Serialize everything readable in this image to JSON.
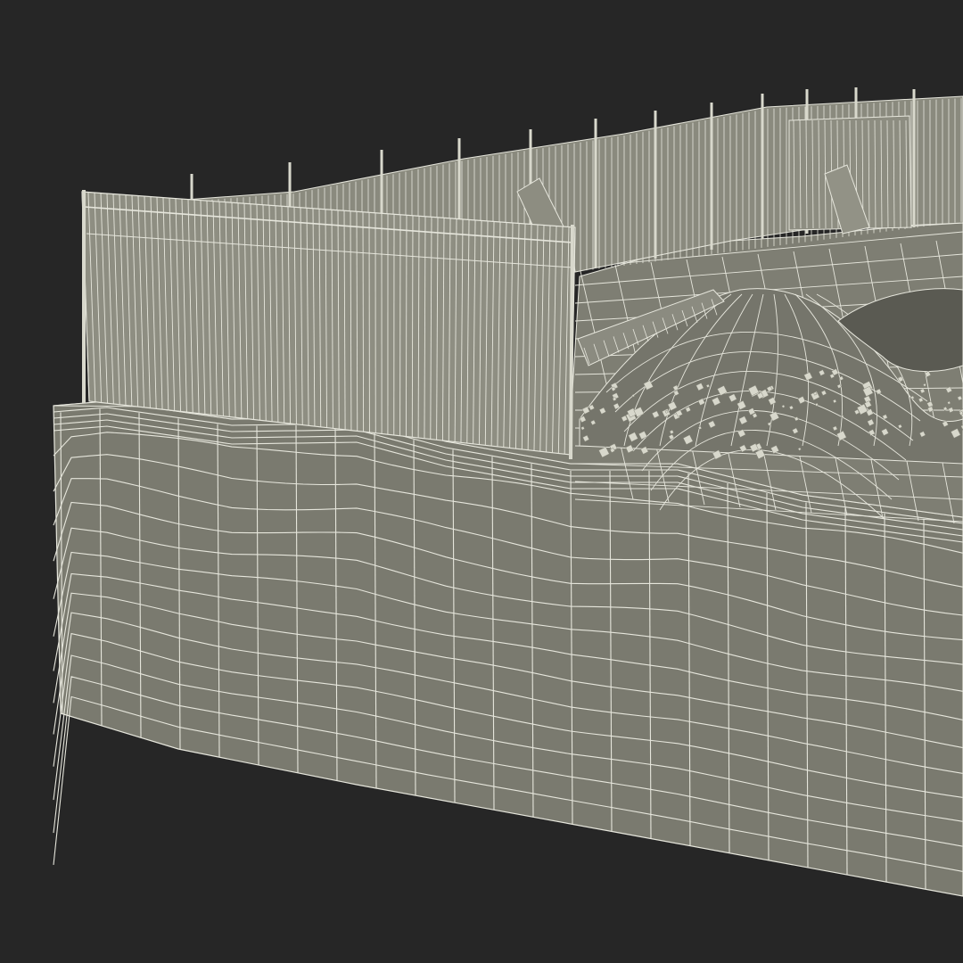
{
  "scene": {
    "subject": "",
    "render_style": "wireframe-on-shaded",
    "colors": {
      "background": "#262626",
      "surface": "#7a7a6f",
      "surface_dark": "#6b6b61",
      "surface_light": "#85857a",
      "wire": "#e6e6dc",
      "fence": "#8a8a7e",
      "fence_dark": "#5f5f56",
      "debris": "#d8d8cc"
    }
  }
}
